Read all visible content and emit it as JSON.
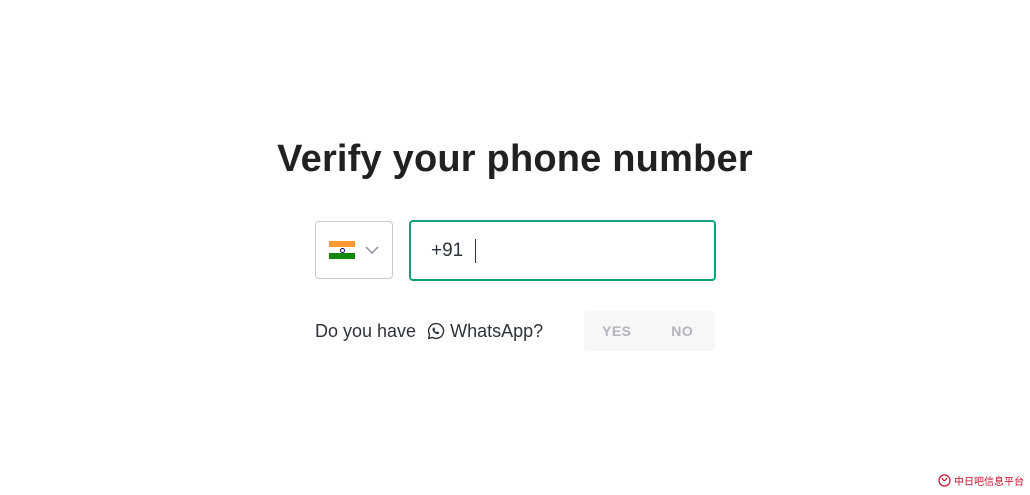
{
  "heading": "Verify your phone number",
  "country_select": {
    "selected_flag": "india-flag-icon",
    "chevron": "chevron-down-icon"
  },
  "phone_input": {
    "value": "+91"
  },
  "whatsapp": {
    "prefix": "Do you have",
    "icon": "whatsapp-icon",
    "label": "WhatsApp?",
    "yes_label": "YES",
    "no_label": "NO"
  },
  "colors": {
    "accent": "#10a37f",
    "text": "#202123",
    "toggle_bg": "#f7f7f8",
    "toggle_text": "#b4b4bd"
  },
  "watermark": {
    "text": "中日吧信息平台"
  }
}
